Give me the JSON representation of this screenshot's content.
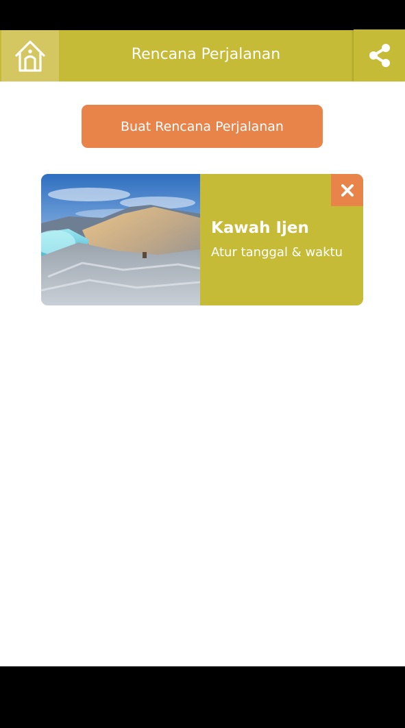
{
  "app_bar": {
    "title": "Rencana Perjalanan",
    "home_icon": "home-icon",
    "share_icon": "share-icon"
  },
  "actions": {
    "create_plan_label": "Buat Rencana Perjalanan"
  },
  "plans": [
    {
      "name": "Kawah Ijen",
      "subtitle": "Atur tanggal & waktu",
      "image": "crater-landscape-photo",
      "remove_icon": "close-icon"
    }
  ],
  "colors": {
    "primary": "#c6bb37",
    "home_button": "#d4c761",
    "accent": "#e8834a",
    "status_bar": "#000000",
    "nav_bar": "#000000",
    "background": "#ffffff"
  }
}
